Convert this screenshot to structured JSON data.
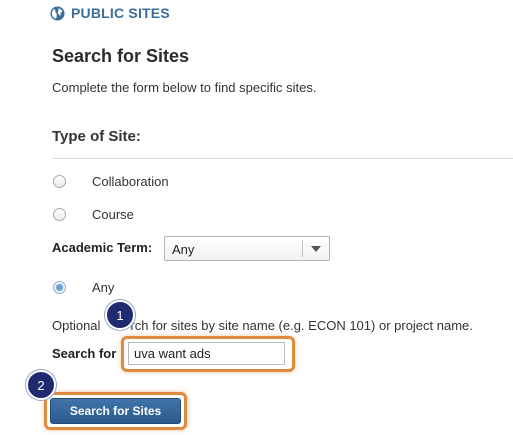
{
  "header": {
    "title": "PUBLIC SITES",
    "icon": "globe-icon",
    "accent": "#3a6d9a"
  },
  "title": "Search for Sites",
  "description": "Complete the form below to find specific sites.",
  "type_of_site": {
    "label": "Type of Site:",
    "options": [
      {
        "label": "Collaboration",
        "checked": false
      },
      {
        "label": "Course",
        "checked": false
      }
    ]
  },
  "academic_term": {
    "label": "Academic Term:",
    "selected": "Any"
  },
  "any_option": {
    "label": "Any",
    "checked": true
  },
  "optional_text": {
    "before": "Optional",
    "after": "rch for sites by site name (e.g. ECON 101) or project name."
  },
  "search": {
    "label": "Search for",
    "value": "uva want ads"
  },
  "submit": {
    "label": "Search for Sites"
  },
  "callouts": [
    {
      "number": "1"
    },
    {
      "number": "2"
    }
  ],
  "highlight_color": "#e08a3d"
}
